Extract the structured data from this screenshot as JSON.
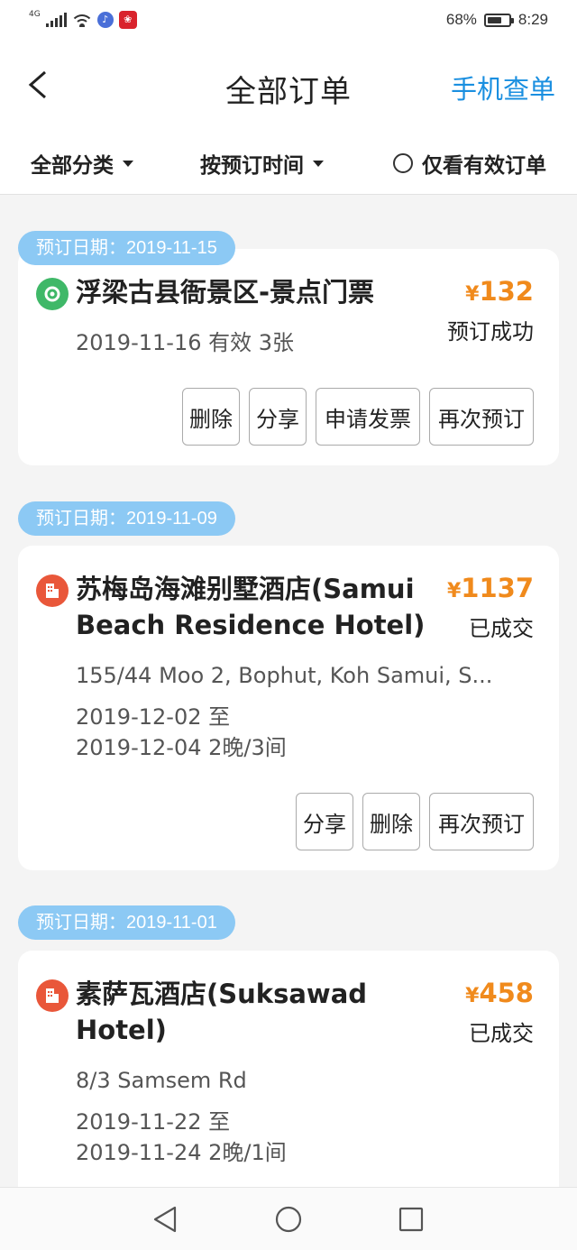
{
  "status_bar": {
    "network": "4G",
    "battery": "68%",
    "battery_level": 0.68,
    "time": "8:29"
  },
  "header": {
    "title": "全部订单",
    "right_action": "手机查单"
  },
  "filters": {
    "category": "全部分类",
    "sort": "按预订时间",
    "valid_only": "仅看有效订单"
  },
  "orders": [
    {
      "date_label": "预订日期：2019-11-15",
      "icon": "ticket-icon",
      "title": "浮梁古县衙景区-景点门票",
      "currency": "¥",
      "price": "132",
      "status": "预订成功",
      "line1": "2019-11-16 有效  3张",
      "buttons": [
        "删除",
        "分享",
        "申请发票",
        "再次预订"
      ]
    },
    {
      "date_label": "预订日期：2019-11-09",
      "icon": "hotel-icon",
      "title": "苏梅岛海滩别墅酒店(Samui Beach Residence Hotel)",
      "currency": "¥",
      "price": "1137",
      "status": "已成交",
      "address": "155/44 Moo 2, Bophut, Koh Samui, S...",
      "line1": "2019-12-02 至",
      "line2": "2019-12-04  2晚/3间",
      "buttons": [
        "分享",
        "删除",
        "再次预订"
      ]
    },
    {
      "date_label": "预订日期：2019-11-01",
      "icon": "hotel-icon",
      "title": "素萨瓦酒店(Suksawad Hotel)",
      "currency": "¥",
      "price": "458",
      "status": "已成交",
      "address": "8/3 Samsem Rd",
      "line1": "2019-11-22 至",
      "line2": "2019-11-24  2晚/1间"
    }
  ],
  "nav": {
    "back": "back-triangle-icon",
    "home": "home-circle-icon",
    "recents": "recents-square-icon"
  },
  "colors": {
    "accent_blue": "#1a8fe0",
    "price_orange": "#f08a1c",
    "date_pill": "#8cc9f4"
  }
}
